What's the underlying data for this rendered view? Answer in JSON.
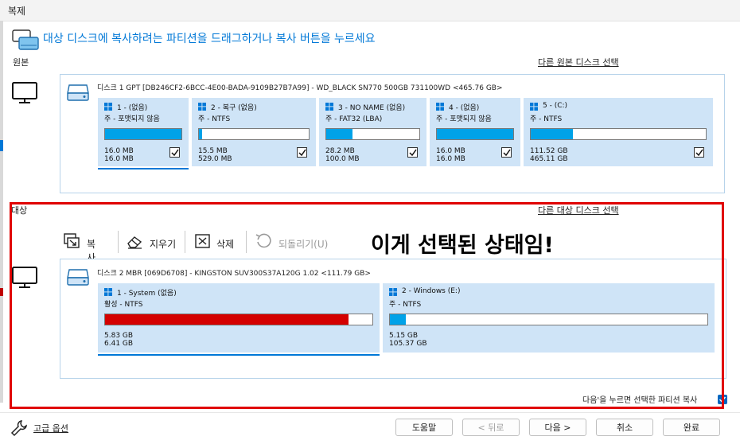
{
  "window": {
    "title": "복제"
  },
  "header": {
    "instruction": "대상 디스크에 복사하려는 파티션을 드래그하거나 복사 버튼을 누르세요"
  },
  "source": {
    "label": "원본",
    "select_link": "다른 원본 디스크 선택",
    "disk_title": "디스크 1 GPT [DB246CF2-6BCC-4E00-BADA-9109B27B7A99] - WD_BLACK SN770 500GB 731100WD  <465.76 GB>",
    "partitions": [
      {
        "name": "1 - (없음)",
        "type": "주 - 포맷되지 않음",
        "used": "16.0 MB",
        "total": "16.0 MB",
        "fill": 1.0,
        "checked": true,
        "color": "#00a2e8",
        "selected": true
      },
      {
        "name": "2 - 복구 (없음)",
        "type": "주 - NTFS",
        "used": "15.5 MB",
        "total": "529.0 MB",
        "fill": 0.03,
        "checked": true,
        "color": "#00a2e8",
        "selected": false
      },
      {
        "name": "3 - NO NAME (없음)",
        "type": "주 - FAT32 (LBA)",
        "used": "28.2 MB",
        "total": "100.0 MB",
        "fill": 0.28,
        "checked": true,
        "color": "#00a2e8",
        "selected": false
      },
      {
        "name": "4 - (없음)",
        "type": "주 - 포맷되지 않음",
        "used": "16.0 MB",
        "total": "16.0 MB",
        "fill": 1.0,
        "checked": true,
        "color": "#00a2e8",
        "selected": false
      },
      {
        "name": "5 - (C:)",
        "type": "주 - NTFS",
        "used": "111.52 GB",
        "total": "465.11 GB",
        "fill": 0.24,
        "checked": true,
        "color": "#00a2e8",
        "selected": false
      }
    ]
  },
  "target": {
    "label": "대상",
    "select_link": "다른 대상 디스크 선택",
    "toolbar": {
      "copy": "복사",
      "erase": "지우기",
      "delete": "삭제",
      "undo": "되돌리기(U)"
    },
    "disk_title": "디스크 2 MBR [069D6708] - KINGSTON  SUV300S37A120G  1.02  <111.79 GB>",
    "partitions": [
      {
        "name": "1 - System (없음)",
        "type": "활성 - NTFS",
        "used": "5.83 GB",
        "total": "6.41 GB",
        "fill": 0.91,
        "color": "#d40000",
        "selected": true
      },
      {
        "name": "2 - Windows (E:)",
        "type": "주 - NTFS",
        "used": "5.15 GB",
        "total": "105.37 GB",
        "fill": 0.05,
        "color": "#00a2e8",
        "selected": false
      }
    ],
    "copy_option": "다음'을 누르면 선택한 파티션 복사"
  },
  "annotation": "이게 선택된 상태임!",
  "footer": {
    "advanced": "고급 옵션",
    "help": "도움말",
    "back": "< 뒤로",
    "next": "다음 >",
    "cancel": "취소",
    "finish": "완료"
  }
}
